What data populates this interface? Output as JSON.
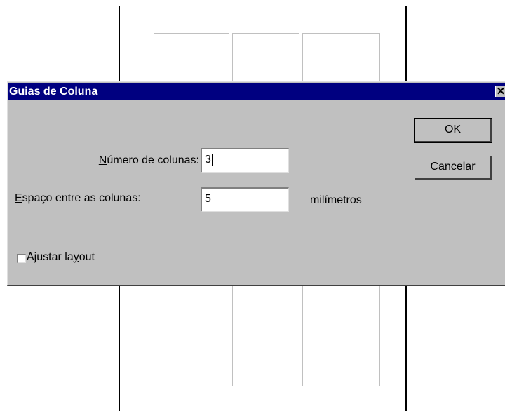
{
  "dialog": {
    "title": "Guias de Coluna",
    "close_glyph": "✕",
    "fields": {
      "columns_label_mnemonic": "N",
      "columns_label_rest": "úmero de colunas:",
      "columns_value": "3",
      "spacing_label_mnemonic": "E",
      "spacing_label_rest": "spaço entre as colunas:",
      "spacing_value": "5",
      "spacing_unit": "milímetros"
    },
    "buttons": {
      "ok": "OK",
      "cancel": "Cancelar"
    },
    "checkbox": {
      "label_before": "Ajustar la",
      "label_mnemonic": "y",
      "label_after": "out",
      "checked": false
    }
  }
}
